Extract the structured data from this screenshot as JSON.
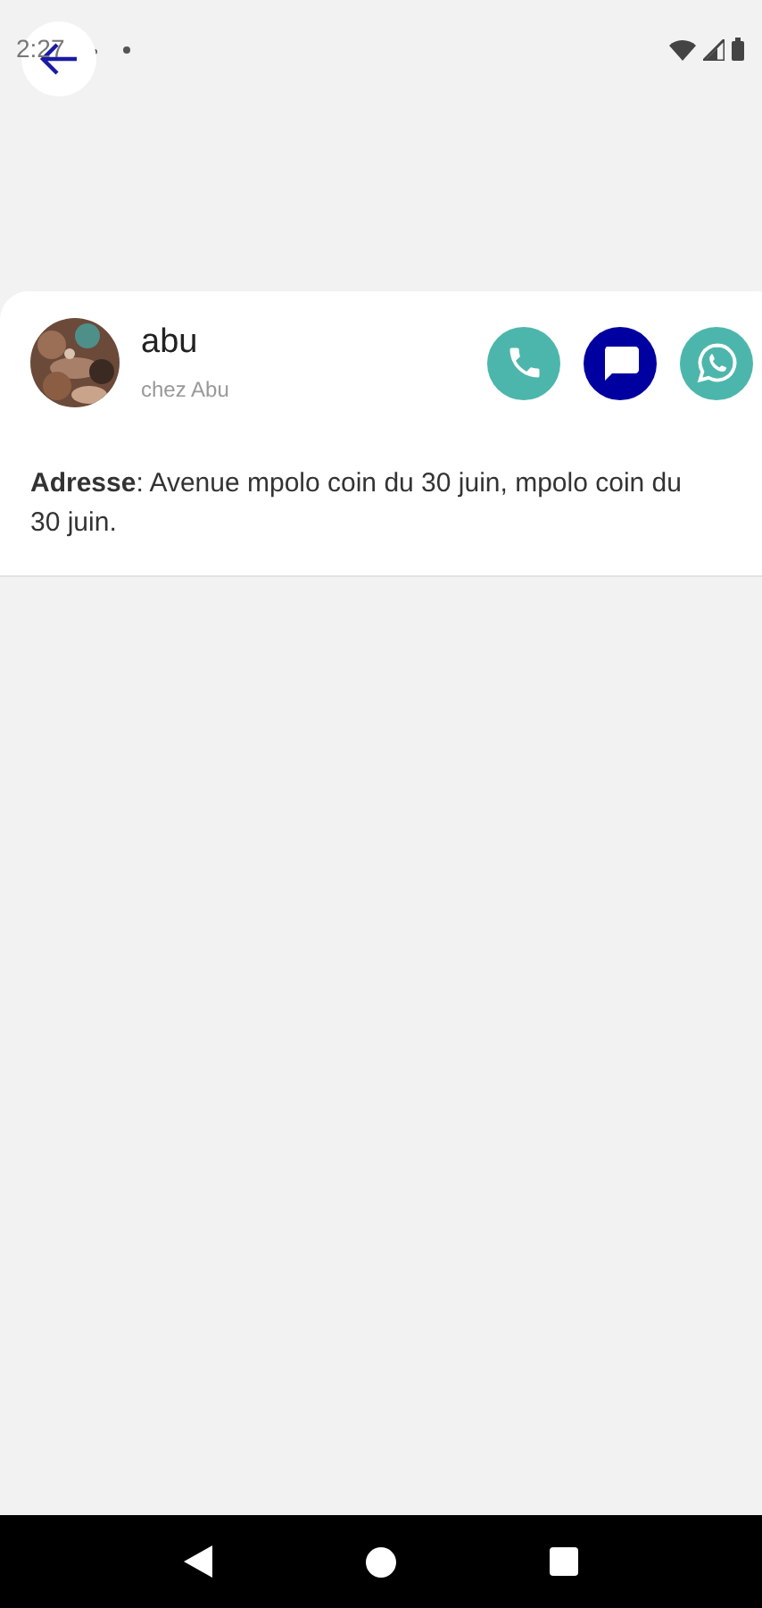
{
  "status_bar": {
    "time": "2:27"
  },
  "contact": {
    "name": "abu",
    "subtitle": "chez Abu",
    "actions": [
      {
        "kind": "phone",
        "color": "#4db6ac"
      },
      {
        "kind": "message",
        "color": "#0000a0"
      },
      {
        "kind": "whatsapp",
        "color": "#4db6ac"
      }
    ],
    "address": "**Adresse**: Avenue mpolo coin du 30 juin, mpolo coin du 30 juin."
  }
}
